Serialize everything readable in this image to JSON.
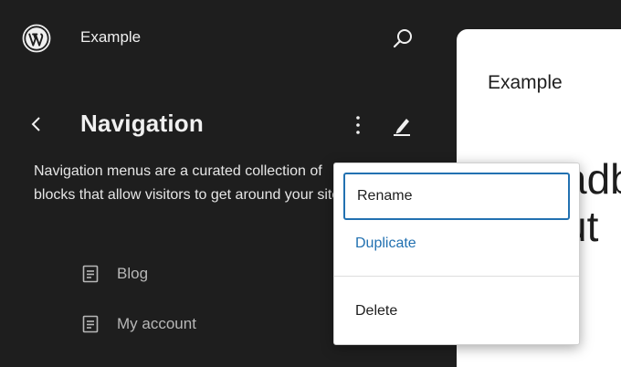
{
  "header": {
    "logo_icon": "wordpress-logo-icon",
    "site_title": "Example",
    "search_icon": "search-icon"
  },
  "navigation_panel": {
    "back_icon": "chevron-left-icon",
    "title": "Navigation",
    "more_icon": "more-vertical-icon",
    "edit_icon": "pencil-icon",
    "description_line1": "Navigation menus are a curated collection of",
    "description_line2": "blocks that allow visitors to get around your site."
  },
  "menu_items": [
    {
      "label": "Blog",
      "icon": "page-icon"
    },
    {
      "label": "My account",
      "icon": "page-icon"
    }
  ],
  "preview": {
    "site_title": "Example",
    "big_line1": "adb",
    "big_line2": "ut"
  },
  "dropdown": {
    "items": [
      {
        "label": "Rename"
      },
      {
        "label": "Duplicate"
      },
      {
        "label": "Delete"
      }
    ],
    "focus_color": "#2271b1"
  }
}
